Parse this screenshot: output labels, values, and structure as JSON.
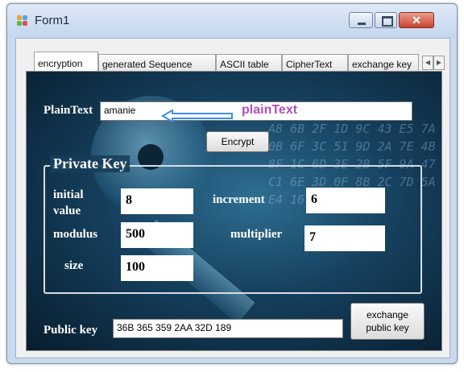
{
  "window": {
    "title": "Form1",
    "minimize_icon": "minimize-icon",
    "maximize_icon": "maximize-icon",
    "close_icon": "close-icon",
    "close_glyph": "✕"
  },
  "tabs": [
    {
      "label": "encryption",
      "active": true
    },
    {
      "label": "generated Sequence",
      "active": false
    },
    {
      "label": "ASCII table",
      "active": false
    },
    {
      "label": "CipherText",
      "active": false
    },
    {
      "label": "exchange key",
      "active": false
    }
  ],
  "tab_scroll": {
    "left": "◀",
    "right": "▶"
  },
  "plaintext": {
    "label": "PlainText",
    "value": "amanie",
    "annotation": "plainText"
  },
  "encrypt_button": "Encrypt",
  "private_key": {
    "legend": "Private Key",
    "initial_value_label": "initial value",
    "initial_value": "8",
    "increment_label": "increment",
    "increment": "6",
    "modulus_label": "modulus",
    "modulus": "500",
    "multiplier_label": "multiplier",
    "multiplier": "7",
    "size_label": "size",
    "size": "100"
  },
  "public_key": {
    "label": "Public key",
    "value": "36B 365 359 2AA 32D 189"
  },
  "exchange_button": "exchange public key",
  "colors": {
    "background_accent": "#15405e",
    "annotation": "#b44ec0",
    "arrow": "#3a8ee6"
  }
}
